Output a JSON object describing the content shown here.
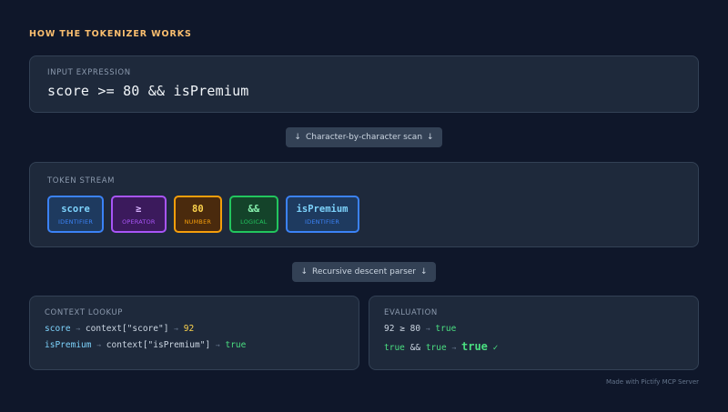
{
  "heading": "HOW THE TOKENIZER WORKS",
  "input": {
    "label": "INPUT EXPRESSION",
    "expression": "score >= 80 && isPremium"
  },
  "step1": {
    "arrow": "↓",
    "label": "Character-by-character scan"
  },
  "tokens": {
    "label": "TOKEN STREAM",
    "items": [
      {
        "value": "score",
        "type": "IDENTIFIER",
        "color": "#7dd3fc",
        "border": "#3b82f6",
        "bg": "#1e3a5f"
      },
      {
        "value": "≥",
        "type": "OPERATOR",
        "color": "#d8b4fe",
        "border": "#a855f7",
        "bg": "#3b1a5c"
      },
      {
        "value": "80",
        "type": "NUMBER",
        "color": "#fcd34d",
        "border": "#f59e0b",
        "bg": "#4a2a0d"
      },
      {
        "value": "&&",
        "type": "LOGICAL",
        "color": "#86efac",
        "border": "#22c55e",
        "bg": "#14432a"
      },
      {
        "value": "isPremium",
        "type": "IDENTIFIER",
        "color": "#7dd3fc",
        "border": "#3b82f6",
        "bg": "#1e3a5f"
      }
    ]
  },
  "step2": {
    "arrow": "↓",
    "label": "Recursive descent parser"
  },
  "context": {
    "label": "CONTEXT LOOKUP",
    "line1": {
      "id": "score",
      "arrow": "→",
      "lookup": "context[\"score\"]",
      "result": "92"
    },
    "line2": {
      "id": "isPremium",
      "arrow": "→",
      "lookup": "context[\"isPremium\"]",
      "result": "true"
    }
  },
  "evaluation": {
    "label": "EVALUATION",
    "line1": {
      "left": "92",
      "op": "≥",
      "right": "80",
      "arrow": "→",
      "result": "true"
    },
    "line2": {
      "left": "true",
      "op": "&&",
      "right": "true",
      "arrow": "→",
      "result": "true",
      "mark": "✓"
    }
  },
  "footer": "Made with Pictify MCP Server"
}
